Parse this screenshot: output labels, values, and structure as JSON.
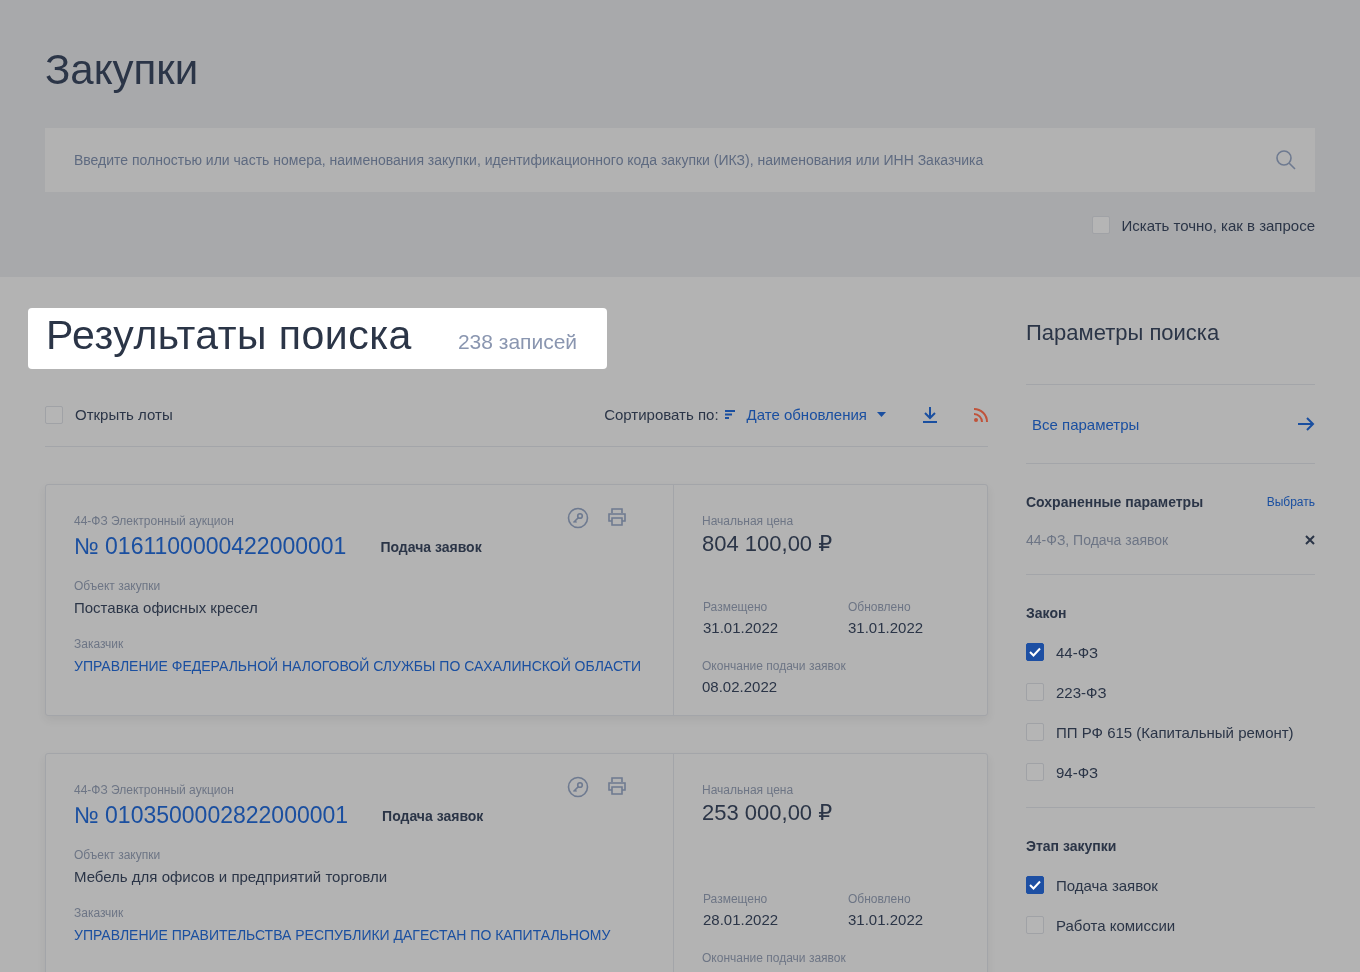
{
  "page_title": "Закупки",
  "search": {
    "placeholder": "Введите полностью или часть номера, наименования закупки, идентификационного кода закупки (ИКЗ), наименования или ИНН Заказчика"
  },
  "exact_search": {
    "label": "Искать точно, как в запросе",
    "checked": false
  },
  "results": {
    "title": "Результаты поиска",
    "count": "238 записей"
  },
  "toolbar": {
    "open_lots": {
      "label": "Открыть лоты",
      "checked": false
    },
    "sort_label": "Сортировать по:",
    "sort_value": "Дате обновления"
  },
  "cards": [
    {
      "type": "44-ФЗ Электронный аукцион",
      "number": "№ 0161100000422000001",
      "status": "Подача заявок",
      "object_label": "Объект закупки",
      "object": "Поставка офисных кресел",
      "customer_label": "Заказчик",
      "customer": "УПРАВЛЕНИЕ ФЕДЕРАЛЬНОЙ НАЛОГОВОЙ СЛУЖБЫ ПО САХАЛИНСКОЙ ОБЛАСТИ",
      "price_label": "Начальная цена",
      "price": "804 100,00 ₽",
      "posted_label": "Размещено",
      "posted": "31.01.2022",
      "updated_label": "Обновлено",
      "updated": "31.01.2022",
      "deadline_label": "Окончание подачи заявок",
      "deadline": "08.02.2022"
    },
    {
      "type": "44-ФЗ Электронный аукцион",
      "number": "№ 0103500002822000001",
      "status": "Подача заявок",
      "object_label": "Объект закупки",
      "object": "Мебель для офисов и предприятий торговли",
      "customer_label": "Заказчик",
      "customer": "УПРАВЛЕНИЕ ПРАВИТЕЛЬСТВА РЕСПУБЛИКИ ДАГЕСТАН ПО КАПИТАЛЬНОМУ",
      "price_label": "Начальная цена",
      "price": "253 000,00 ₽",
      "posted_label": "Размещено",
      "posted": "28.01.2022",
      "updated_label": "Обновлено",
      "updated": "31.01.2022",
      "deadline_label": "Окончание подачи заявок"
    }
  ],
  "sidebar": {
    "title": "Параметры поиска",
    "all_params": "Все параметры",
    "saved": {
      "title": "Сохраненные параметры",
      "action": "Выбрать",
      "value": "44-ФЗ, Подача заявок"
    },
    "groups": [
      {
        "title": "Закон",
        "options": [
          {
            "label": "44-ФЗ",
            "checked": true
          },
          {
            "label": "223-ФЗ",
            "checked": false
          },
          {
            "label": "ПП РФ 615 (Капитальный ремонт)",
            "checked": false
          },
          {
            "label": "94-ФЗ",
            "checked": false
          }
        ]
      },
      {
        "title": "Этап закупки",
        "options": [
          {
            "label": "Подача заявок",
            "checked": true
          },
          {
            "label": "Работа комиссии",
            "checked": false
          }
        ]
      }
    ]
  }
}
